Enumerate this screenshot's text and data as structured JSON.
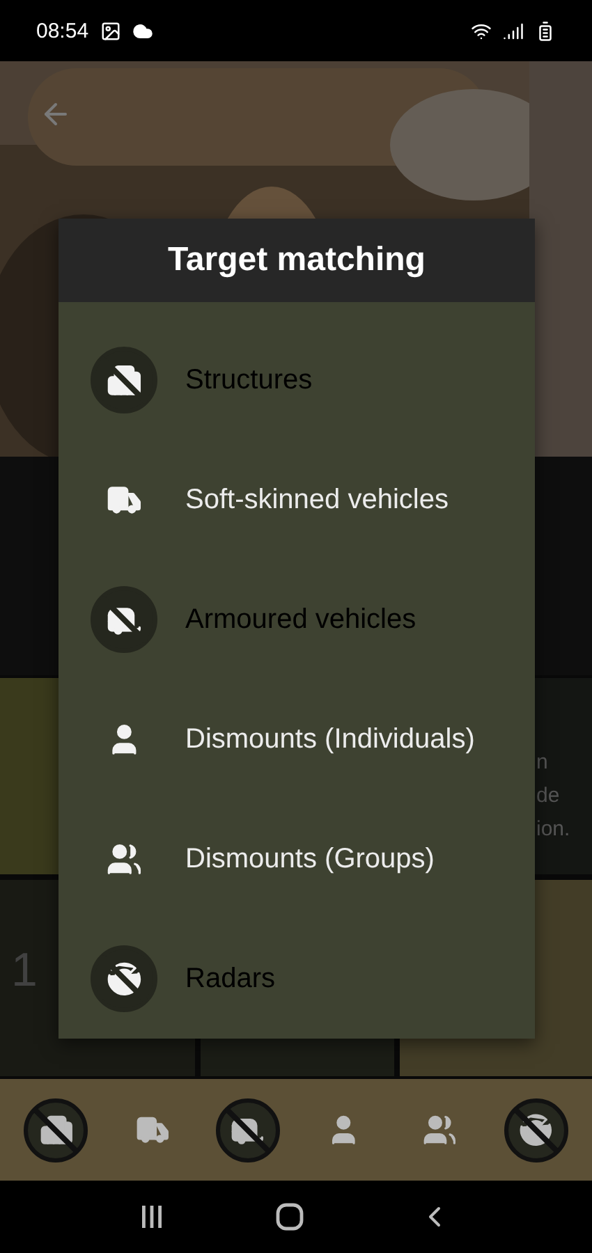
{
  "status_bar": {
    "time": "08:54"
  },
  "dialog": {
    "title": "Target matching",
    "items": [
      {
        "kind": "building",
        "label": "Structures",
        "enabled": false
      },
      {
        "kind": "truck",
        "label": "Soft-skinned vehicles",
        "enabled": true
      },
      {
        "kind": "tank",
        "label": "Armoured vehicles",
        "enabled": false
      },
      {
        "kind": "person",
        "label": "Dismounts (Individuals)",
        "enabled": true
      },
      {
        "kind": "group",
        "label": "Dismounts (Groups)",
        "enabled": true
      },
      {
        "kind": "radar",
        "label": "Radars",
        "enabled": false
      }
    ]
  },
  "background_tiles": [
    {
      "kind": "blank"
    },
    {
      "kind": "text",
      "lines": [
        "n",
        "de",
        "ion."
      ]
    },
    {
      "kind": "number",
      "number": "1"
    },
    {
      "kind": "blank"
    },
    {
      "kind": "blank"
    }
  ]
}
